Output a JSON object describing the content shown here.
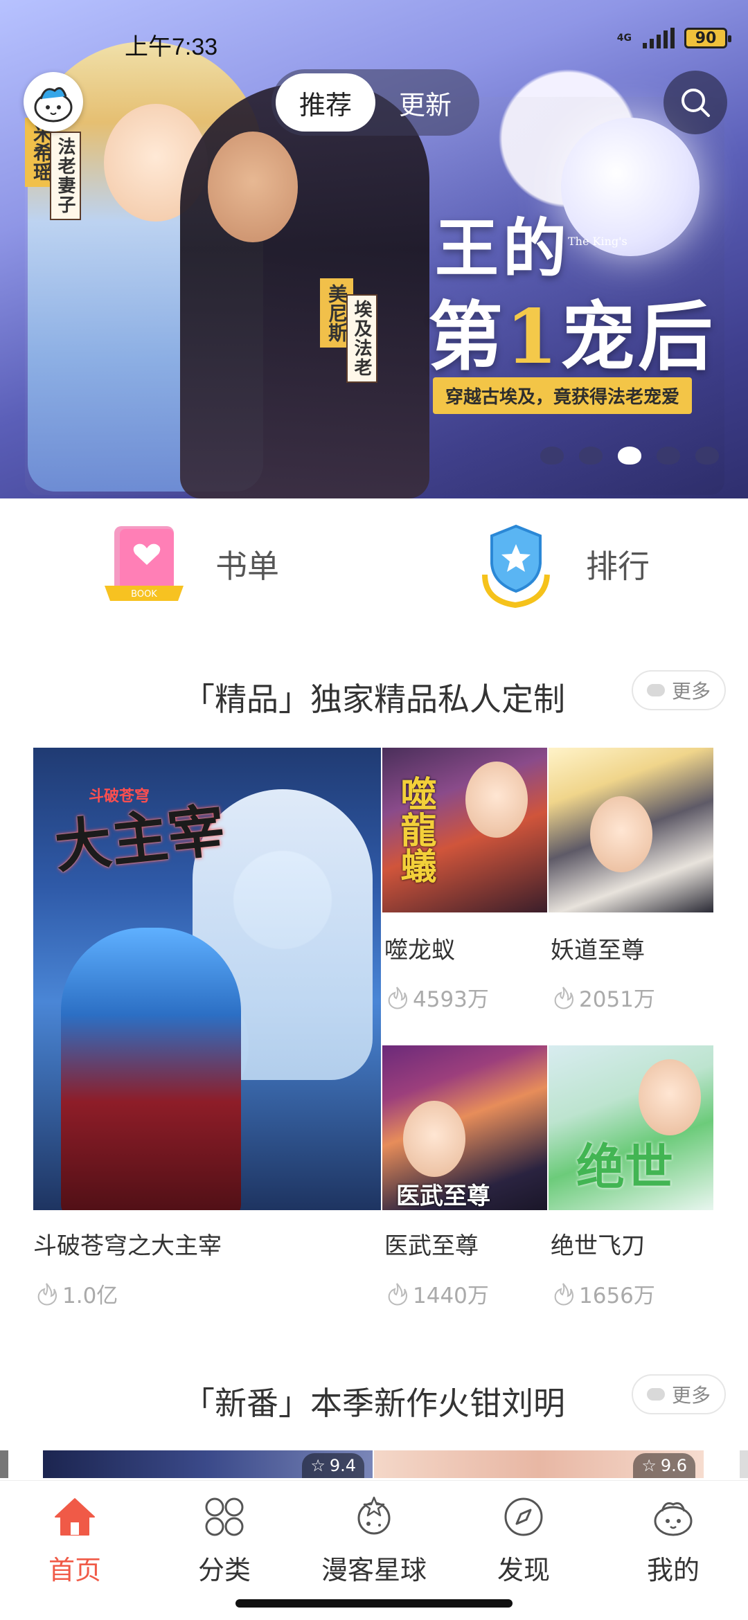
{
  "status_bar": {
    "time": "上午7:33",
    "network": "4G",
    "battery": "90"
  },
  "top_tabs": [
    {
      "label": "推荐",
      "active": true
    },
    {
      "label": "更新",
      "active": false
    }
  ],
  "banner": {
    "title_line1": "王的",
    "title_line2_prefix": "第",
    "title_line2_num": "1",
    "title_line2_suffix": "宠后",
    "english": "The King's",
    "tagline": "穿越古埃及，竟获得法老宠爱",
    "tag_role1": "法老妻子",
    "tag_name1": "米希瑶",
    "tag_role2": "埃及法老",
    "tag_name2": "美尼斯",
    "dots": 5,
    "active_dot": 3
  },
  "shortcuts": [
    {
      "label": "书单",
      "icon": "book-heart-icon"
    },
    {
      "label": "排行",
      "icon": "shield-star-icon"
    }
  ],
  "section_premium": {
    "title": "「精品」独家精品私人定制",
    "more": "更多",
    "items": [
      {
        "title": "斗破苍穹之大主宰",
        "heat": "1.0亿",
        "cover_text": "大主宰",
        "cover_sub": "斗破苍穹"
      },
      {
        "title": "噬龙蚁",
        "heat": "4593万",
        "cover_text": "噬龍蟻"
      },
      {
        "title": "妖道至尊",
        "heat": "2051万"
      },
      {
        "title": "医武至尊",
        "heat": "1440万",
        "cover_text": "医武至尊"
      },
      {
        "title": "绝世飞刀",
        "heat": "1656万",
        "cover_text": "绝世飞刀"
      }
    ]
  },
  "section_new": {
    "title": "「新番」本季新作火钳刘明",
    "more": "更多",
    "ratings": [
      "9.4",
      "9.6"
    ]
  },
  "bottom_nav": [
    {
      "label": "首页",
      "icon": "home-icon",
      "active": true
    },
    {
      "label": "分类",
      "icon": "category-icon",
      "active": false
    },
    {
      "label": "漫客星球",
      "icon": "planet-icon",
      "active": false
    },
    {
      "label": "发现",
      "icon": "compass-icon",
      "active": false
    },
    {
      "label": "我的",
      "icon": "profile-icon",
      "active": false
    }
  ],
  "colors": {
    "accent": "#f05a47",
    "text": "#333333",
    "muted": "#aaaaaa",
    "badge_yellow": "#f3c547"
  }
}
